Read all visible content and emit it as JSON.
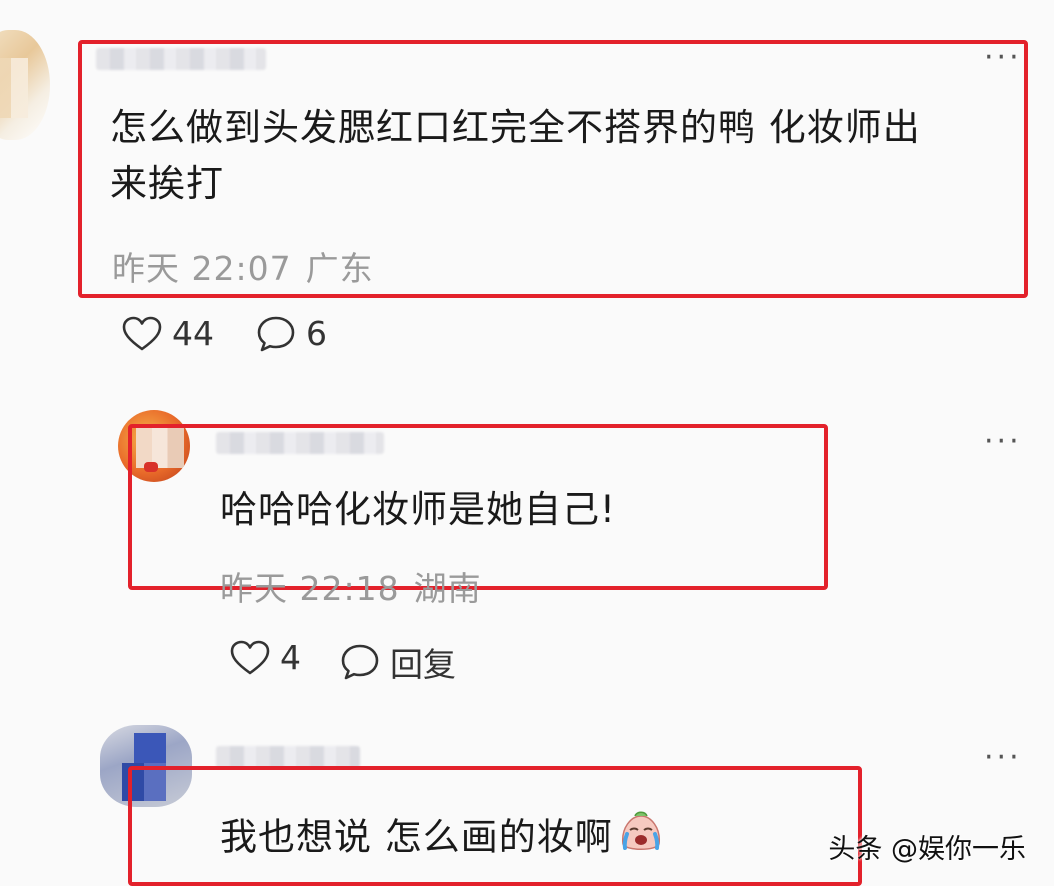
{
  "comments": [
    {
      "text_line1": "怎么做到头发腮红口红完全不搭界的鸭 化妆师出",
      "text_line2": "来挨打",
      "time": "昨天 22:07",
      "location": "广东",
      "likes": "44",
      "replies": "6",
      "more": "···"
    },
    {
      "text": "哈哈哈化妆师是她自己!",
      "time": "昨天 22:18",
      "location": "湖南",
      "likes": "4",
      "reply_label": "回复",
      "more": "···"
    },
    {
      "text": "我也想说 怎么画的妆啊",
      "emoji": "crying-face-emoji",
      "more": "···"
    }
  ],
  "watermark": "头条 @娱你一乐",
  "colors": {
    "highlight": "#e3212b",
    "meta_text": "#9a9a9a",
    "background": "#fafafa"
  }
}
